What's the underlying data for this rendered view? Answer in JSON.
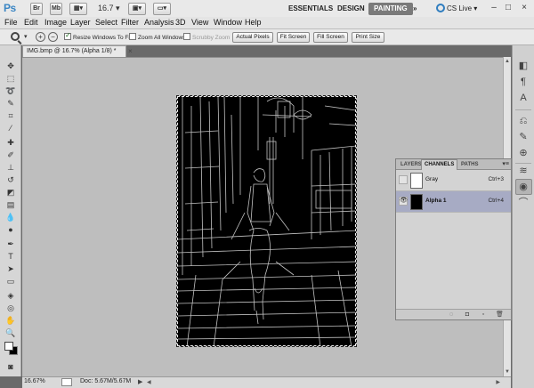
{
  "app": {
    "logo": "Ps",
    "zoom_value": "16.7",
    "workspaces": [
      "ESSENTIALS",
      "DESIGN",
      "PAINTING"
    ],
    "active_workspace": "PAINTING",
    "cs_live": "CS Live"
  },
  "menu": [
    "File",
    "Edit",
    "Image",
    "Layer",
    "Select",
    "Filter",
    "Analysis",
    "3D",
    "View",
    "Window",
    "Help"
  ],
  "options": {
    "resize_windows": "Resize Windows To Fit",
    "zoom_all_windows": "Zoom All Windows",
    "scrubby_zoom": "Scrubby Zoom",
    "actual_pixels": "Actual Pixels",
    "fit_screen": "Fit Screen",
    "fill_screen": "Fill Screen",
    "print_size": "Print Size"
  },
  "document": {
    "tab_title": "IMG.bmp @ 16.7% (Alpha 1/8) *",
    "close_symbol": "×"
  },
  "status": {
    "zoom": "16.67%",
    "doc": "Doc: 5.67M/5.67M",
    "arrow": "▶"
  },
  "panel": {
    "tabs": [
      "LAYERS",
      "CHANNELS",
      "PATHS"
    ],
    "active_tab": "CHANNELS",
    "channels": [
      {
        "name": "Gray",
        "shortcut": "Ctrl+3",
        "visible": false,
        "selected": false,
        "thumb": "#ffffff"
      },
      {
        "name": "Alpha 1",
        "shortcut": "Ctrl+4",
        "visible": true,
        "selected": true,
        "thumb": "#000000"
      }
    ]
  },
  "colors": {
    "canvas_bg": "#bebebe",
    "selected_row": "#a7abc4",
    "accent": "#3b86c4"
  }
}
